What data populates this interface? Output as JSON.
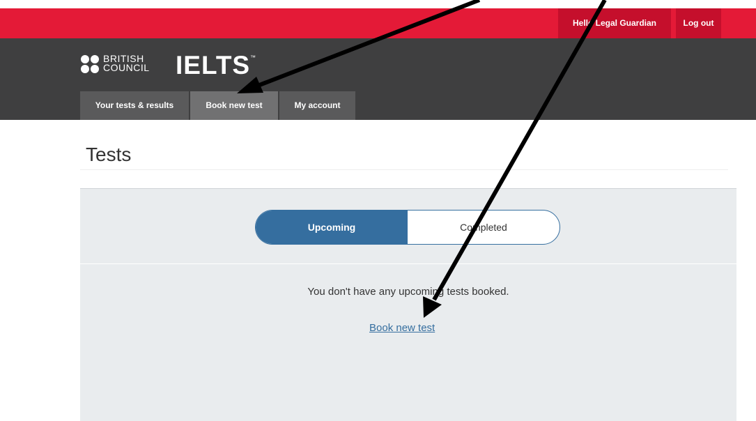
{
  "header": {
    "user_greeting": "Hello Legal Guardian",
    "logout_label": "Log out",
    "brand_line1": "BRITISH",
    "brand_line2": "COUNCIL",
    "product_name": "IELTS",
    "trademark": "™"
  },
  "tabs": [
    {
      "label": "Your tests & results"
    },
    {
      "label": "Book new test"
    },
    {
      "label": "My account"
    }
  ],
  "main": {
    "title": "Tests",
    "toggle": {
      "active": "Upcoming",
      "inactive": "Completed"
    },
    "empty_message": "You don't have any upcoming tests booked.",
    "book_link": "Book new test"
  },
  "colors": {
    "brand_red": "#e41a37",
    "header_dark": "#3f3f40",
    "accent_blue": "#356e9f",
    "panel_bg": "#e9ecee"
  }
}
